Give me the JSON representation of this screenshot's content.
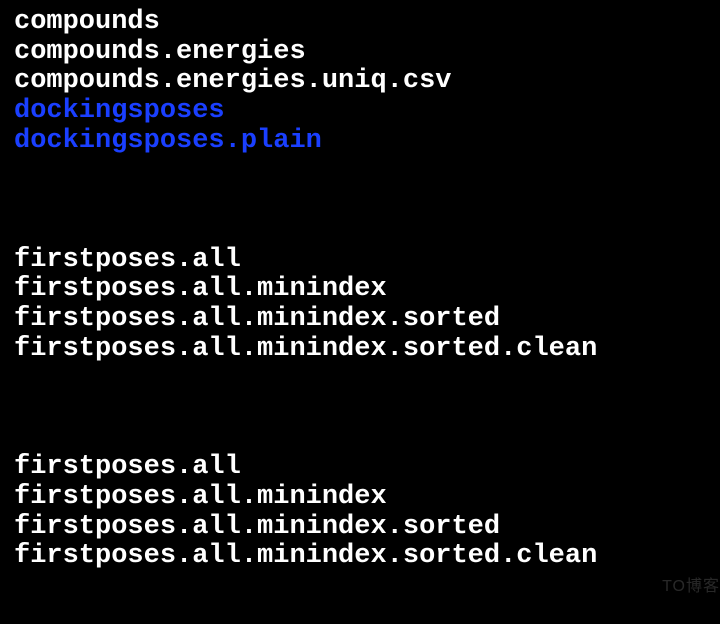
{
  "terminal": {
    "blocks": [
      {
        "lines": [
          {
            "text": "compounds",
            "type": "file"
          },
          {
            "text": "compounds.energies",
            "type": "file"
          },
          {
            "text": "compounds.energies.uniq.csv",
            "type": "file"
          },
          {
            "text": "dockingsposes",
            "type": "dir"
          },
          {
            "text": "dockingsposes.plain",
            "type": "dir"
          }
        ]
      },
      {
        "lines": [
          {
            "text": "firstposes.all",
            "type": "file"
          },
          {
            "text": "firstposes.all.minindex",
            "type": "file"
          },
          {
            "text": "firstposes.all.minindex.sorted",
            "type": "file"
          },
          {
            "text": "firstposes.all.minindex.sorted.clean",
            "type": "file"
          }
        ]
      },
      {
        "lines": [
          {
            "text": "firstposes.all",
            "type": "file"
          },
          {
            "text": "firstposes.all.minindex",
            "type": "file"
          },
          {
            "text": "firstposes.all.minindex.sorted",
            "type": "file"
          },
          {
            "text": "firstposes.all.minindex.sorted.clean",
            "type": "file"
          }
        ]
      }
    ]
  },
  "watermark": "TO博客",
  "colors": {
    "background": "#000000",
    "file": "#ffffff",
    "directory": "#1a3fff"
  }
}
